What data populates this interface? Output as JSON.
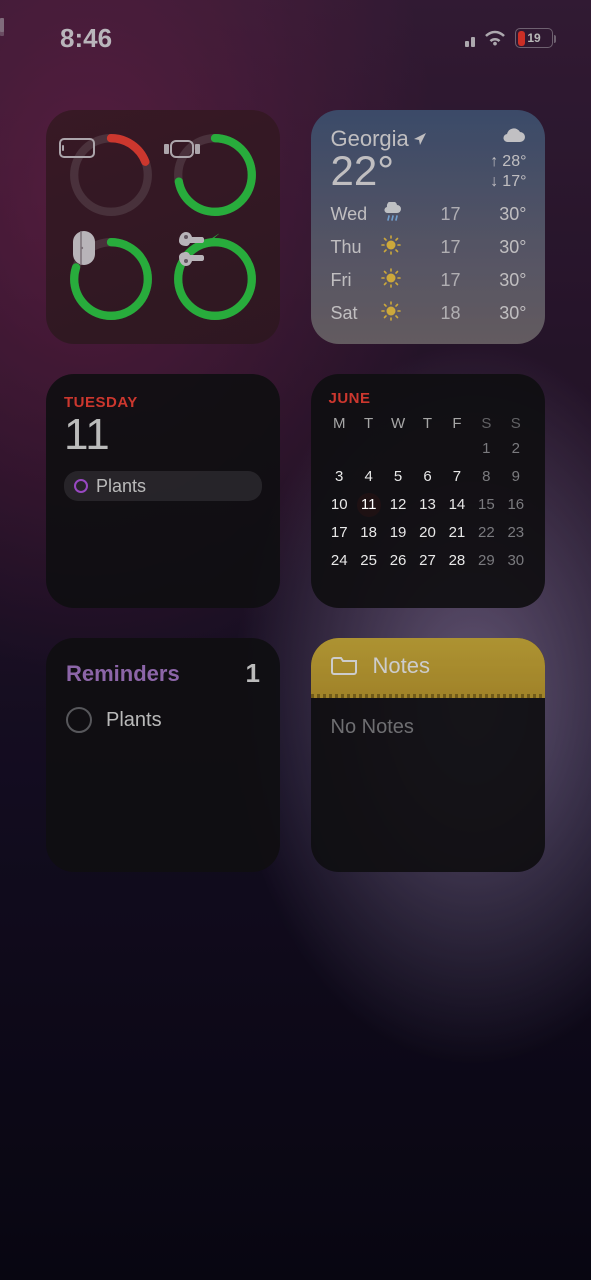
{
  "status": {
    "time": "8:46",
    "battery_pct": "19",
    "cell_bars_active": 2,
    "cell_bars_total": 4
  },
  "batteries": {
    "devices": [
      {
        "name": "iPhone",
        "pct": 19,
        "color": "#ff453a",
        "charging": false
      },
      {
        "name": "Apple Watch",
        "pct": 72,
        "color": "#32d74b",
        "charging": false
      },
      {
        "name": "AirPods Case",
        "pct": 80,
        "color": "#32d74b",
        "charging": false
      },
      {
        "name": "AirPods",
        "pct": 100,
        "color": "#32d74b",
        "charging": true
      }
    ]
  },
  "weather": {
    "location": "Georgia",
    "temp": "22°",
    "hi": "28°",
    "lo": "17°",
    "forecast": [
      {
        "day": "Wed",
        "icon": "rain",
        "lo": "17",
        "hi": "30°"
      },
      {
        "day": "Thu",
        "icon": "sun",
        "lo": "17",
        "hi": "30°"
      },
      {
        "day": "Fri",
        "icon": "sun",
        "lo": "17",
        "hi": "30°"
      },
      {
        "day": "Sat",
        "icon": "sun",
        "lo": "18",
        "hi": "30°"
      }
    ]
  },
  "today": {
    "dow": "TUESDAY",
    "daynum": "11",
    "event": "Plants"
  },
  "month": {
    "title": "JUNE",
    "headers": [
      "M",
      "T",
      "W",
      "T",
      "F",
      "S",
      "S"
    ],
    "days": [
      [
        "",
        "",
        "",
        "",
        "",
        "1",
        "2"
      ],
      [
        "3",
        "4",
        "5",
        "6",
        "7",
        "8",
        "9"
      ],
      [
        "10",
        "11",
        "12",
        "13",
        "14",
        "15",
        "16"
      ],
      [
        "17",
        "18",
        "19",
        "20",
        "21",
        "22",
        "23"
      ],
      [
        "24",
        "25",
        "26",
        "27",
        "28",
        "29",
        "30"
      ]
    ],
    "today": "11"
  },
  "reminders": {
    "title": "Reminders",
    "count": "1",
    "items": [
      "Plants"
    ]
  },
  "notes": {
    "title": "Notes",
    "body": "No Notes"
  }
}
